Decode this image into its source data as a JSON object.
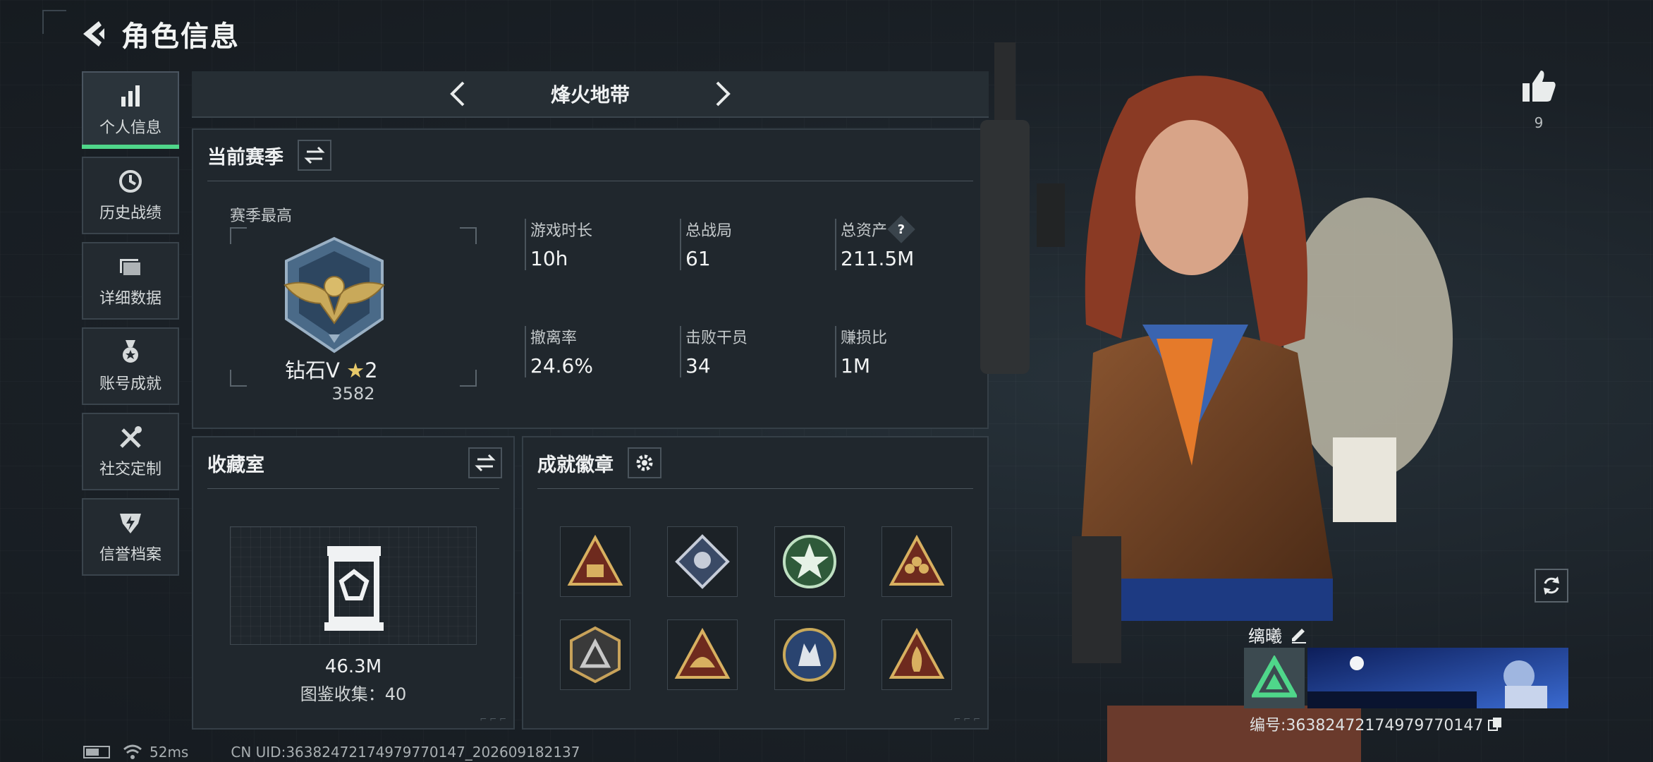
{
  "header": {
    "title": "角色信息"
  },
  "sidebar": {
    "items": [
      {
        "label": "个人信息",
        "icon": "bar-chart-icon",
        "active": true
      },
      {
        "label": "历史战绩",
        "icon": "clock-icon"
      },
      {
        "label": "详细数据",
        "icon": "folder-icon"
      },
      {
        "label": "账号成就",
        "icon": "medal-icon"
      },
      {
        "label": "社交定制",
        "icon": "tools-icon"
      },
      {
        "label": "信誉档案",
        "icon": "shield-bolt-icon"
      }
    ]
  },
  "mode_selector": {
    "title": "烽火地带"
  },
  "season": {
    "title": "当前赛季",
    "best_label": "赛季最高",
    "rank_name": "钻石Ⅴ",
    "rank_stars": "2",
    "rank_points": "3582",
    "stats": [
      {
        "label": "游戏时长",
        "value": "10h"
      },
      {
        "label": "总战局",
        "value": "61"
      },
      {
        "label": "总资产",
        "value": "211.5M",
        "help": "?"
      },
      {
        "label": "撤离率",
        "value": "24.6%"
      },
      {
        "label": "击败干员",
        "value": "34"
      },
      {
        "label": "赚损比",
        "value": "1M"
      }
    ]
  },
  "collection": {
    "title": "收藏室",
    "value": "46.3M",
    "count_text": "图鉴收集：40"
  },
  "badges": {
    "title": "成就徽章",
    "items": [
      "triangle-crate-badge",
      "diamond-drone-badge",
      "green-star-badge",
      "triangle-squad-badge",
      "hex-triangle-badge",
      "triangle-helmet-badge",
      "round-wolf-badge",
      "triangle-flame-badge"
    ]
  },
  "player": {
    "name": "缡曦",
    "id_text": "编号:3638247217497977014​7",
    "likes": "9"
  },
  "status_bar": {
    "ping": "52ms",
    "uid": "CN UID:36382472174979770147_202609182137"
  },
  "colors": {
    "accent": "#4fd68a",
    "panel": "#20272d",
    "border": "#353f47"
  }
}
